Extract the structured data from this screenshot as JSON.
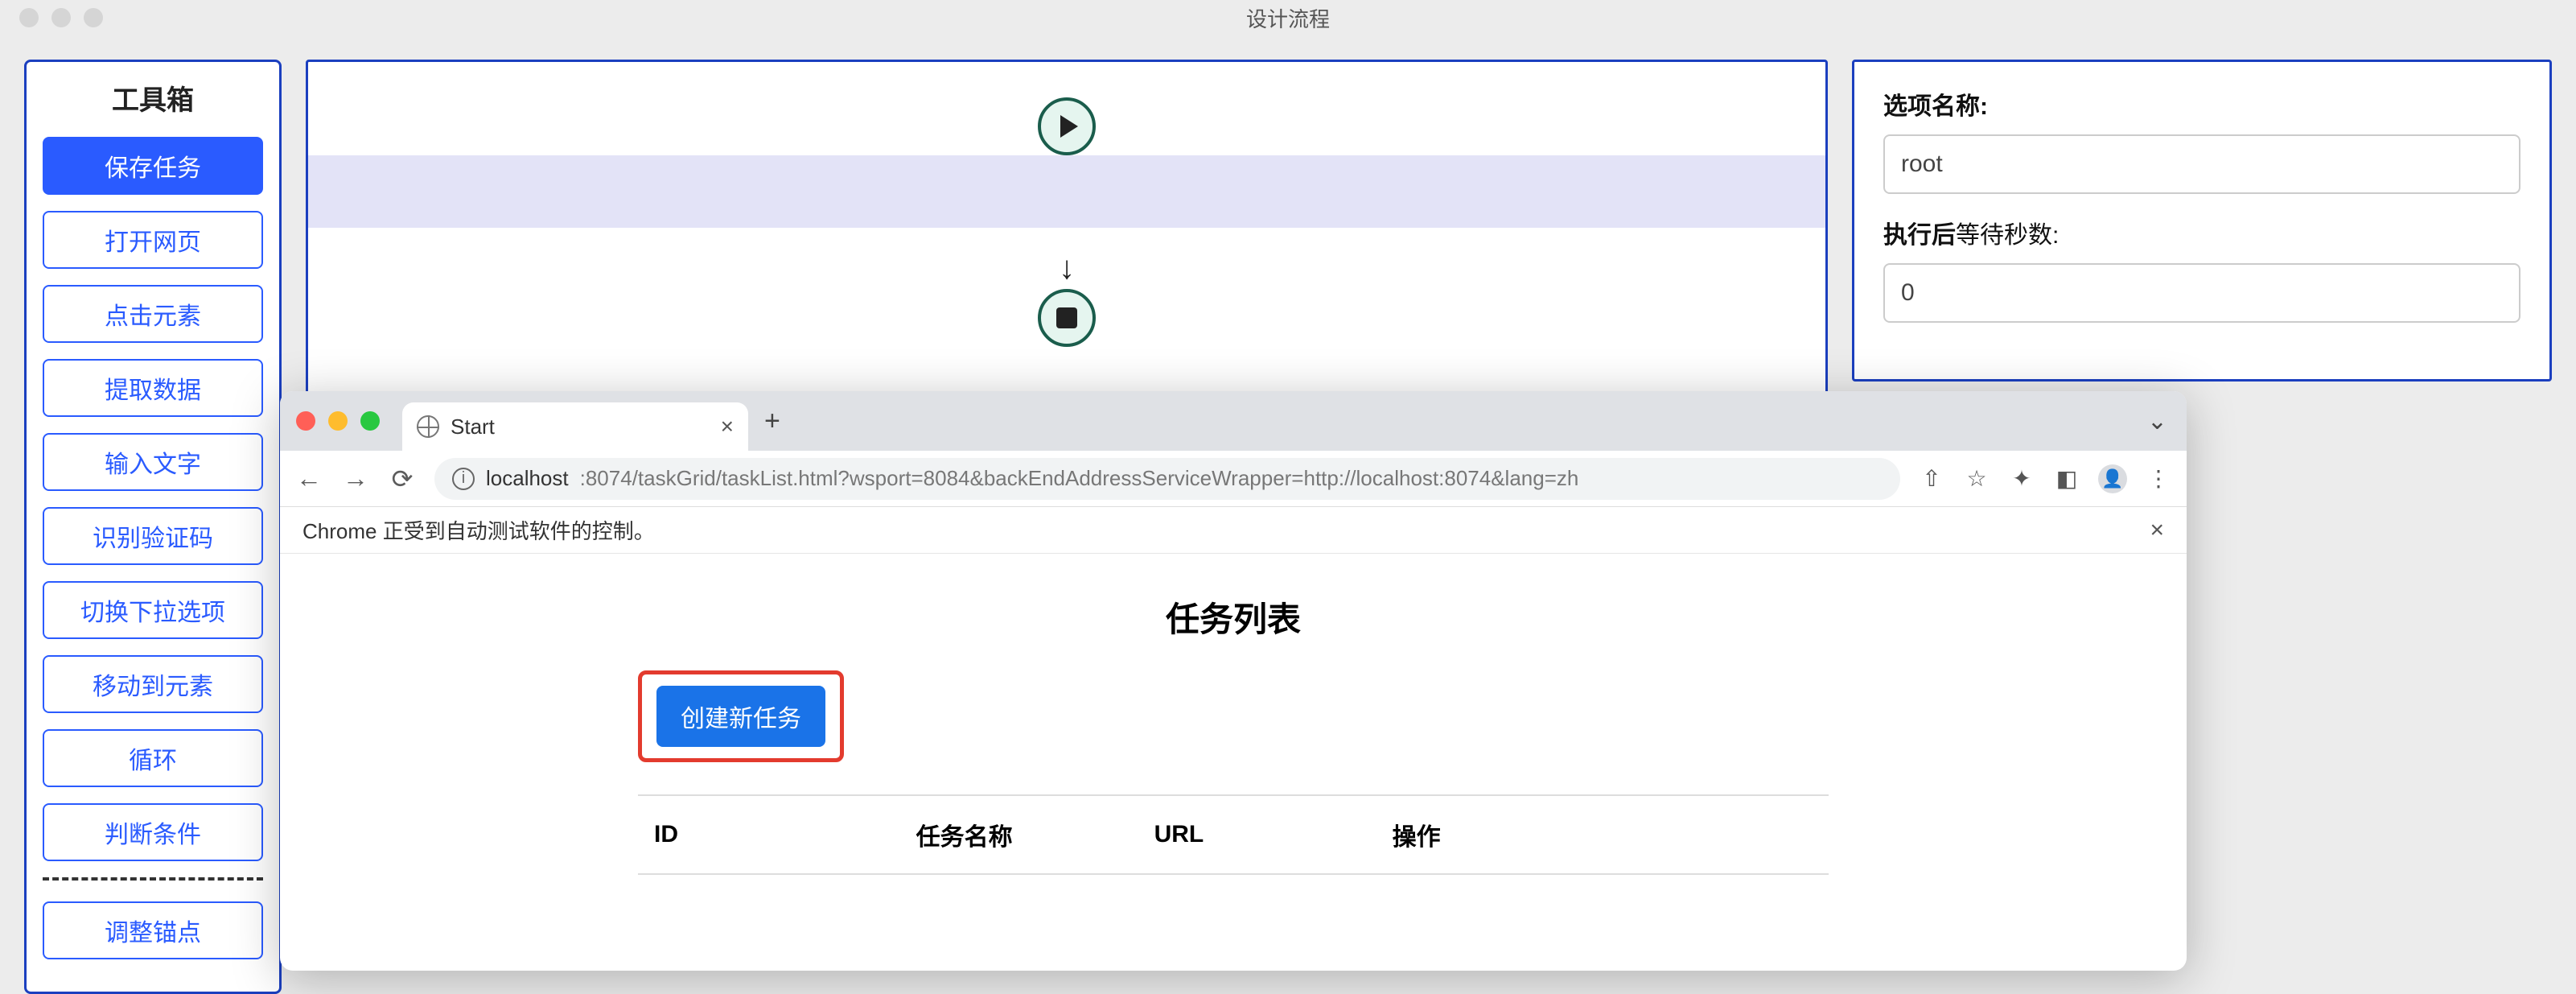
{
  "app": {
    "title": "设计流程"
  },
  "toolbox": {
    "title": "工具箱",
    "save": "保存任务",
    "items": [
      "打开网页",
      "点击元素",
      "提取数据",
      "输入文字",
      "识别验证码",
      "切换下拉选项",
      "移动到元素",
      "循环",
      "判断条件"
    ],
    "anchor": "调整锚点"
  },
  "props": {
    "name_label": "选项名称:",
    "name_value": "root",
    "wait_label_bold": "执行后",
    "wait_label_rest": "等待秒数:",
    "wait_value": "0"
  },
  "browser": {
    "tab_title": "Start",
    "url_host": "localhost",
    "url_rest": ":8074/taskGrid/taskList.html?wsport=8084&backEndAddressServiceWrapper=http://localhost:8074&lang=zh",
    "infobar": "Chrome 正受到自动测试软件的控制。",
    "page_title": "任务列表",
    "create_btn": "创建新任务",
    "columns": [
      "ID",
      "任务名称",
      "URL",
      "操作"
    ]
  }
}
